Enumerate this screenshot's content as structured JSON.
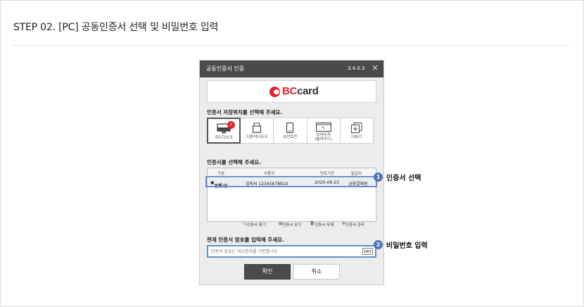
{
  "page": {
    "title": "STEP 02. [PC] 공동인증서 선택 및 비밀번호 입력"
  },
  "window": {
    "title": "공동인증서 인증",
    "version": "3.4.0.3",
    "close": "×",
    "logo": {
      "bc": "BC",
      "card": "card"
    }
  },
  "location": {
    "label": "인증서 저장위치를 선택해 주세요.",
    "items": [
      {
        "label": "하드디스크",
        "icon": "monitor-icon",
        "selected": true
      },
      {
        "label": "이동식디스크",
        "icon": "usb-icon",
        "selected": false
      },
      {
        "label": "보안토큰",
        "icon": "token-icon",
        "selected": false
      },
      {
        "label": "브라우저",
        "label2": "(클라우드)",
        "icon": "browser-icon",
        "selected": false
      },
      {
        "label": "더보기",
        "icon": "more-icon",
        "selected": false
      }
    ]
  },
  "certificates": {
    "label": "인증서를 선택해 주세요.",
    "columns": [
      "구분",
      "사용자",
      "만료기간",
      "발급자"
    ],
    "rows": [
      {
        "type": "은행/신...",
        "user": "김비씨 12345678910",
        "expiry": "2020-09-23",
        "issuer": "금융결제원"
      }
    ],
    "actions": [
      "인증서 찾기",
      "인증서 보기",
      "인증서 삭제",
      "인증서 관리"
    ]
  },
  "password": {
    "label": "현재 인증서 암호를 입력해 주세요.",
    "placeholder": "인증서 암호는 대소문자를 구분합니다."
  },
  "buttons": {
    "ok": "확인",
    "cancel": "취소"
  },
  "callouts": [
    {
      "num": "1",
      "text": "인증서 선택"
    },
    {
      "num": "2",
      "text": "비밀번호 입력"
    }
  ],
  "colors": {
    "accent": "#4e74b3",
    "brand": "#e0222c",
    "titlebar": "#4a4a4a"
  }
}
